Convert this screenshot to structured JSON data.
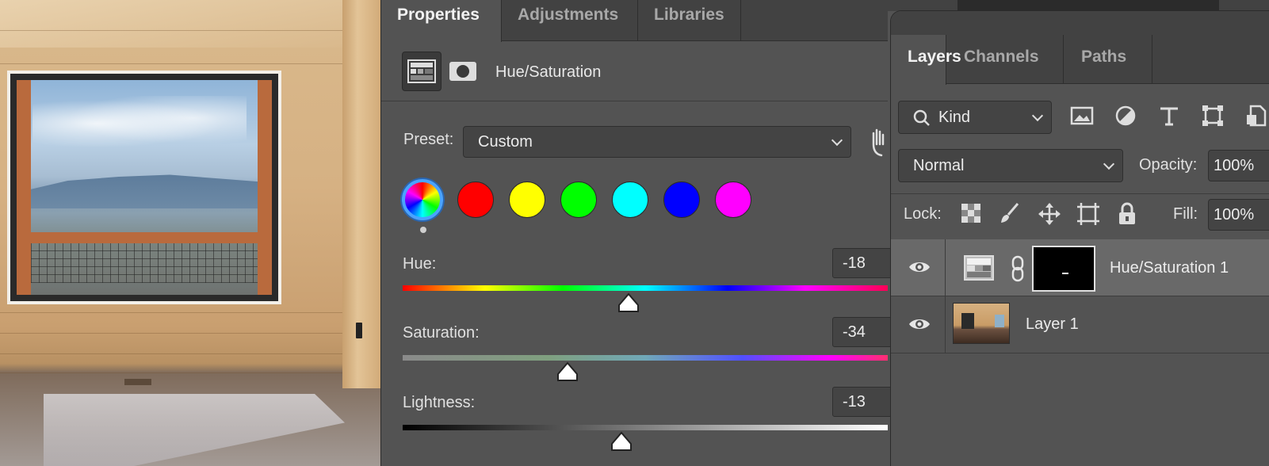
{
  "properties": {
    "tabs": [
      "Properties",
      "Adjustments",
      "Libraries"
    ],
    "title": "Hue/Saturation",
    "preset_label": "Preset:",
    "preset_value": "Custom",
    "swatches": [
      {
        "name": "master",
        "color": "conic"
      },
      {
        "name": "reds",
        "color": "#ff0000"
      },
      {
        "name": "yellows",
        "color": "#ffff00"
      },
      {
        "name": "greens",
        "color": "#00ff00"
      },
      {
        "name": "cyans",
        "color": "#00ffff"
      },
      {
        "name": "blues",
        "color": "#0000ff"
      },
      {
        "name": "magentas",
        "color": "#ff00ff"
      }
    ],
    "hue": {
      "label": "Hue:",
      "value": "-18"
    },
    "saturation": {
      "label": "Saturation:",
      "value": "-34"
    },
    "lightness": {
      "label": "Lightness:",
      "value": "-13"
    }
  },
  "layers": {
    "tabs": [
      "Layers",
      "Channels",
      "Paths"
    ],
    "filter_kind": "Kind",
    "blend_mode": "Normal",
    "opacity_label": "Opacity:",
    "opacity_value": "100%",
    "lock_label": "Lock:",
    "fill_label": "Fill:",
    "fill_value": "100%",
    "items": [
      {
        "name": "Hue/Saturation 1",
        "selected": true,
        "visible": true
      },
      {
        "name": "Layer 1",
        "selected": false,
        "visible": true
      }
    ]
  },
  "colors": {
    "panel_bg": "#535353",
    "tab_bar_bg": "#424242",
    "selected_row": "#696969",
    "accent": "#4aa3ff"
  }
}
